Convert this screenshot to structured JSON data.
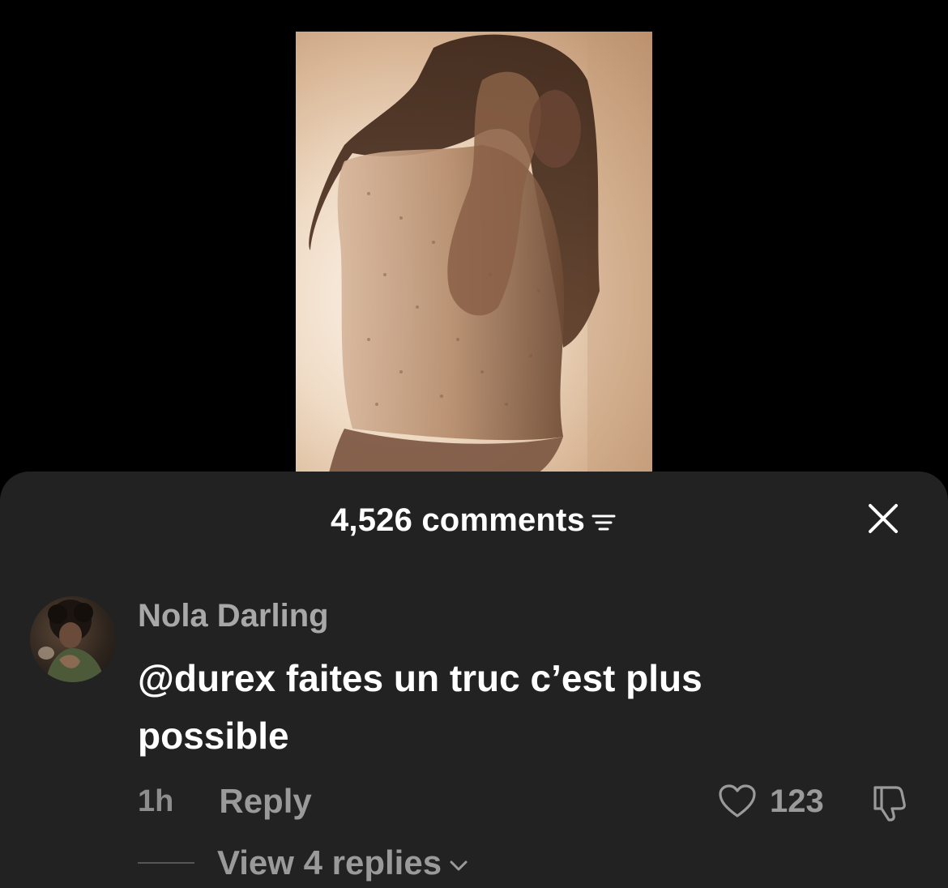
{
  "sheet": {
    "comments_count": "4,526 comments"
  },
  "comment": {
    "username": "Nola Darling",
    "text": "@durex faites un truc c’est plus possible",
    "time": "1h",
    "reply_label": "Reply",
    "likes": "123",
    "view_replies": "View 4 replies"
  },
  "icons": {
    "sort": "sort-icon",
    "close": "close-icon",
    "like": "heart-icon",
    "dislike": "thumbs-down-icon",
    "expand": "chevron-down-icon"
  },
  "colors": {
    "sheet_bg": "#222222",
    "page_bg": "#000000",
    "muted_text": "#9a9a9a",
    "username": "#a8a8a8"
  }
}
